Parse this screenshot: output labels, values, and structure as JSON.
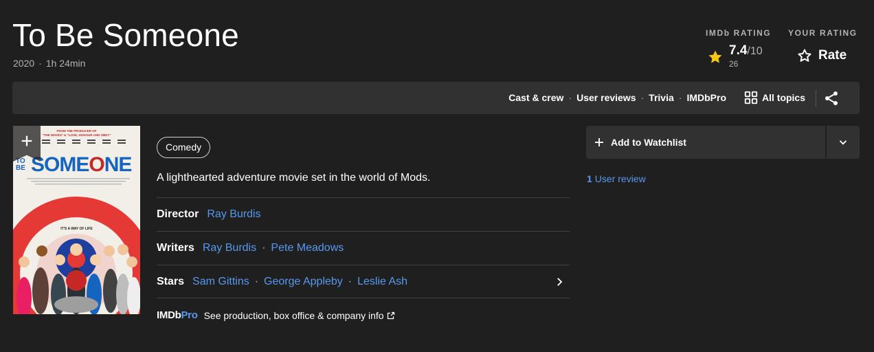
{
  "title": "To Be Someone",
  "meta": {
    "year": "2020",
    "separator": "·",
    "runtime": "1h 24min"
  },
  "imdb_rating": {
    "label": "IMDb RATING",
    "value": "7.4",
    "out_of": "/10",
    "count": "26"
  },
  "your_rating": {
    "label": "YOUR RATING",
    "action": "Rate"
  },
  "subnav": {
    "links": [
      "Cast & crew",
      "User reviews",
      "Trivia",
      "IMDbPro"
    ],
    "separator": "·",
    "all_topics": "All topics"
  },
  "poster": {
    "producer_line": "FROM THE PRODUCER OF",
    "producer_titles": "\"THE WAVES\" & \"LOVE, HONOUR AND OBEY\"",
    "title_small": "TO BE",
    "title_big_a": "SOME",
    "title_big_b": "O",
    "title_big_c": "NE",
    "tagline": "IT'S A WAY OF LIFE"
  },
  "genre": "Comedy",
  "plot": "A lighthearted adventure movie set in the world of Mods.",
  "credits": {
    "director": {
      "label": "Director",
      "names": [
        "Ray Burdis"
      ]
    },
    "writers": {
      "label": "Writers",
      "names": [
        "Ray Burdis",
        "Pete Meadows"
      ]
    },
    "stars": {
      "label": "Stars",
      "names": [
        "Sam Gittins",
        "George Appleby",
        "Leslie Ash"
      ]
    },
    "separator": "·"
  },
  "imdbpro": {
    "logo_a": "IMDb",
    "logo_b": "Pro",
    "text": "See production, box office & company info"
  },
  "watchlist": {
    "label": "Add to Watchlist"
  },
  "user_review": {
    "count": "1",
    "label": "User review"
  },
  "colors": {
    "background": "#1f1f1f",
    "panel": "#313131",
    "link": "#5799ef",
    "star": "#f5c518",
    "muted": "#b3b3b3"
  }
}
